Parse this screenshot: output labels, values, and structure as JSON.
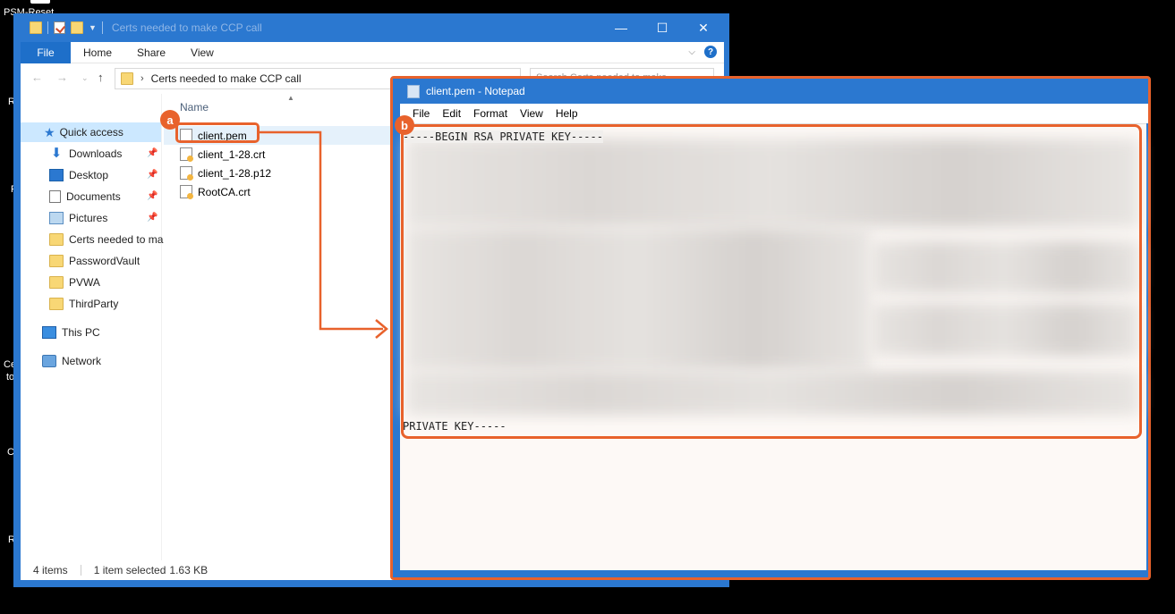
{
  "desktop": {
    "label_top": "PSM-Reset",
    "fragments": [
      "R",
      "F",
      "Ce",
      "to",
      "C",
      "R"
    ]
  },
  "explorer": {
    "title": "Certs needed to make CCP call",
    "ribbon_tabs": [
      "File",
      "Home",
      "Share",
      "View"
    ],
    "window_controls": {
      "minimize": "—",
      "maximize": "☐",
      "close": "✕"
    },
    "help_glyph": "?",
    "address": {
      "path": "Certs needed to make CCP call"
    },
    "search_placeholder": "Search Certs needed to make...",
    "nav": {
      "quick_access": "Quick access",
      "items": [
        {
          "label": "Downloads",
          "icon": "download-icon",
          "pinned": true
        },
        {
          "label": "Desktop",
          "icon": "desktop-icon",
          "pinned": true
        },
        {
          "label": "Documents",
          "icon": "documents-icon",
          "pinned": true
        },
        {
          "label": "Pictures",
          "icon": "pictures-icon",
          "pinned": true
        },
        {
          "label": "Certs needed to ma",
          "icon": "folder-icon",
          "pinned": false
        },
        {
          "label": "PasswordVault",
          "icon": "folder-icon",
          "pinned": false
        },
        {
          "label": "PVWA",
          "icon": "folder-icon",
          "pinned": false
        },
        {
          "label": "ThirdParty",
          "icon": "folder-icon",
          "pinned": false
        }
      ],
      "this_pc": "This PC",
      "network": "Network"
    },
    "column_name": "Name",
    "files": [
      {
        "name": "client.pem",
        "icon": "pem-file-icon",
        "selected": true
      },
      {
        "name": "client_1-28.crt",
        "icon": "certificate-icon",
        "selected": false
      },
      {
        "name": "client_1-28.p12",
        "icon": "certificate-icon",
        "selected": false
      },
      {
        "name": "RootCA.crt",
        "icon": "certificate-icon",
        "selected": false
      }
    ],
    "status": {
      "count": "4 items",
      "selection": "1 item selected",
      "size": "1.63 KB"
    }
  },
  "callouts": {
    "a": "a",
    "b": "b"
  },
  "notepad": {
    "title": "client.pem - Notepad",
    "menu": [
      "File",
      "Edit",
      "Format",
      "View",
      "Help"
    ],
    "line_begin": "-----BEGIN RSA PRIVATE KEY-----",
    "line_end": "PRIVATE KEY-----"
  },
  "colors": {
    "accent": "#e8622c",
    "window_blue": "#2b78d0"
  }
}
